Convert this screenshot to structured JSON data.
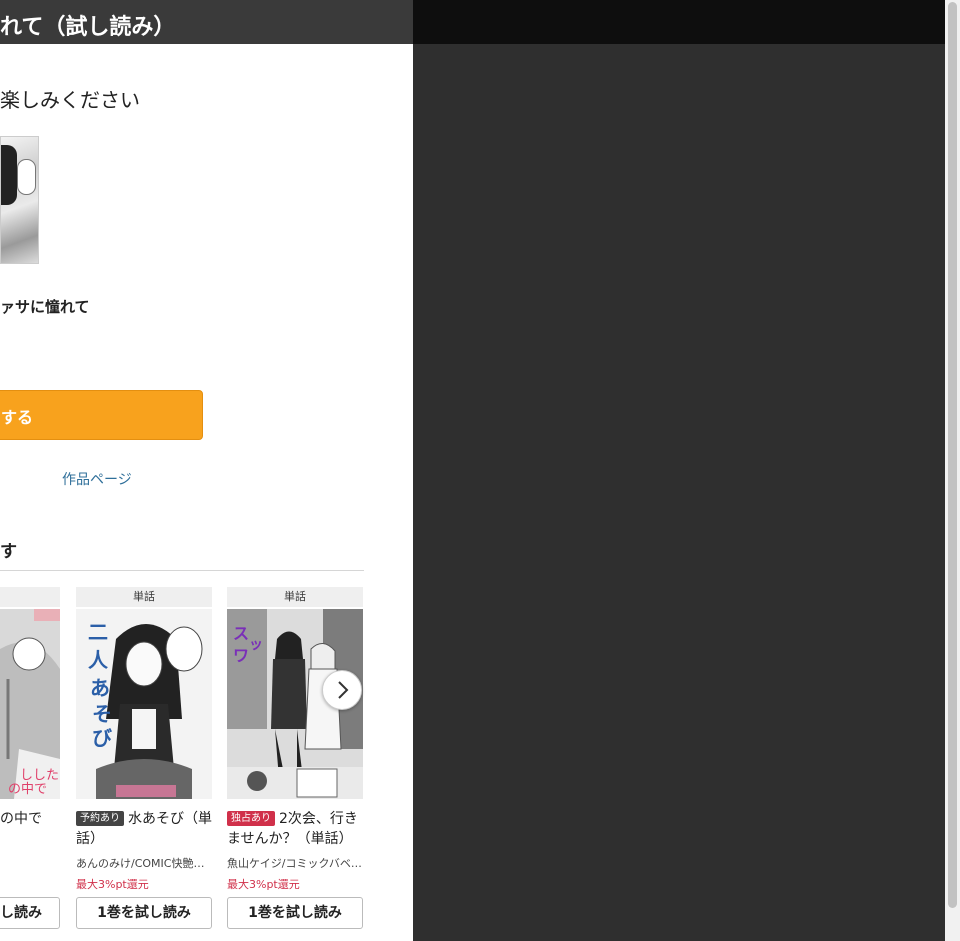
{
  "header": {
    "title": "れて（試し読み）"
  },
  "reader": {
    "thanks": "楽しみください",
    "book_title": "ァサに憧れて",
    "buy_label": "する",
    "work_link": "作品ページ"
  },
  "recommend": {
    "heading": "す",
    "cards": [
      {
        "type": "話",
        "badge": "",
        "title": "の中で",
        "author": "",
        "points": "",
        "button": "し読み"
      },
      {
        "type": "単話",
        "badge": "予約あり",
        "title": "水あそび（単話）",
        "author": "あんのみけ/COMIC快艶…",
        "points": "最大3%pt還元",
        "button": "1巻を試し読み"
      },
      {
        "type": "単話",
        "badge": "独占あり",
        "title": "2次会、行きませんか？（単話）",
        "author": "魚山ケイジ/コミックバベ…",
        "points": "最大3%pt還元",
        "button": "1巻を試し読み"
      }
    ]
  },
  "icons": {
    "next": "chevron-right-icon",
    "cover": "manga-cover-image"
  },
  "colors": {
    "buy_button": "#f8a21d",
    "link": "#2f6f9a",
    "points": "#d0304a",
    "viewer_background": "#2f2f2f"
  }
}
